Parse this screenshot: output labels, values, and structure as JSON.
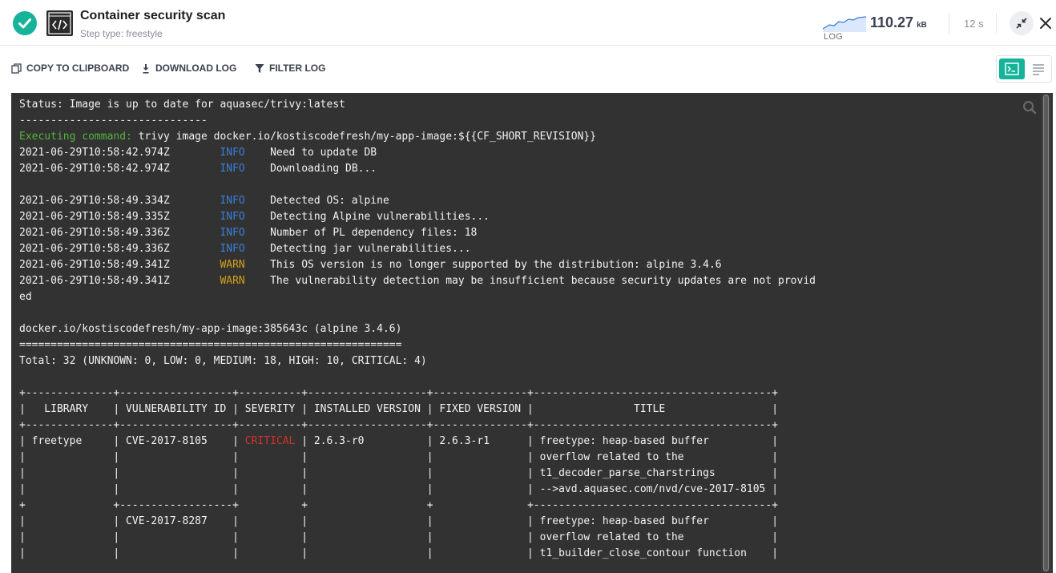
{
  "header": {
    "title": "Container security scan",
    "subtitle": "Step type: freestyle",
    "status_icon": "check-circle",
    "step_icon": "code-brackets",
    "log_label": "LOG",
    "log_size_value": "110.27",
    "log_size_unit": "kB",
    "duration": "12 s",
    "accent_color": "#15b39a"
  },
  "toolbar": {
    "copy_label": "COPY TO CLIPBOARD",
    "download_label": "DOWNLOAD LOG",
    "filter_label": "FILTER LOG"
  },
  "log": {
    "background": "#323232",
    "lines": [
      [
        {
          "t": "Status: Image is up to date for aquasec/trivy:latest"
        }
      ],
      [
        {
          "t": "------------------------------"
        }
      ],
      [
        {
          "t": "Executing command:",
          "c": "cmd"
        },
        {
          "t": " trivy image docker.io/kostiscodefresh/my-app-image:${{CF_SHORT_REVISION}}"
        }
      ],
      [
        {
          "t": "2021-06-29T10:58:42.974Z        "
        },
        {
          "t": "INFO",
          "c": "info"
        },
        {
          "t": "    Need to update DB"
        }
      ],
      [
        {
          "t": "2021-06-29T10:58:42.974Z        "
        },
        {
          "t": "INFO",
          "c": "info"
        },
        {
          "t": "    Downloading DB..."
        }
      ],
      [
        {
          "t": ""
        }
      ],
      [
        {
          "t": "2021-06-29T10:58:49.334Z        "
        },
        {
          "t": "INFO",
          "c": "info"
        },
        {
          "t": "    Detected OS: alpine"
        }
      ],
      [
        {
          "t": "2021-06-29T10:58:49.335Z        "
        },
        {
          "t": "INFO",
          "c": "info"
        },
        {
          "t": "    Detecting Alpine vulnerabilities..."
        }
      ],
      [
        {
          "t": "2021-06-29T10:58:49.336Z        "
        },
        {
          "t": "INFO",
          "c": "info"
        },
        {
          "t": "    Number of PL dependency files: 18"
        }
      ],
      [
        {
          "t": "2021-06-29T10:58:49.336Z        "
        },
        {
          "t": "INFO",
          "c": "info"
        },
        {
          "t": "    Detecting jar vulnerabilities..."
        }
      ],
      [
        {
          "t": "2021-06-29T10:58:49.341Z        "
        },
        {
          "t": "WARN",
          "c": "warn"
        },
        {
          "t": "    This OS version is no longer supported by the distribution: alpine 3.4.6"
        }
      ],
      [
        {
          "t": "2021-06-29T10:58:49.341Z        "
        },
        {
          "t": "WARN",
          "c": "warn"
        },
        {
          "t": "    The vulnerability detection may be insufficient because security updates are not provid"
        }
      ],
      [
        {
          "t": "ed"
        }
      ],
      [
        {
          "t": ""
        }
      ],
      [
        {
          "t": "docker.io/kostiscodefresh/my-app-image:385643c (alpine 3.4.6)"
        }
      ],
      [
        {
          "t": "============================================================="
        }
      ],
      [
        {
          "t": "Total: 32 (UNKNOWN: 0, LOW: 0, MEDIUM: 18, HIGH: 10, CRITICAL: 4)"
        }
      ],
      [
        {
          "t": ""
        }
      ],
      [
        {
          "t": "+--------------+------------------+----------+-------------------+---------------+--------------------------------------+"
        }
      ],
      [
        {
          "t": "|   LIBRARY    | VULNERABILITY ID | SEVERITY | INSTALLED VERSION | FIXED VERSION |                TITLE                 |"
        }
      ],
      [
        {
          "t": "+--------------+------------------+----------+-------------------+---------------+--------------------------------------+"
        }
      ],
      [
        {
          "t": "| freetype     | CVE-2017-8105    | "
        },
        {
          "t": "CRITICAL",
          "c": "crit"
        },
        {
          "t": " | 2.6.3-r0          | 2.6.3-r1      | freetype: heap-based buffer          |"
        }
      ],
      [
        {
          "t": "|              |                  |          |                   |               | overflow related to the              |"
        }
      ],
      [
        {
          "t": "|              |                  |          |                   |               | t1_decoder_parse_charstrings         |"
        }
      ],
      [
        {
          "t": "|              |                  |          |                   |               | -->avd.aquasec.com/nvd/cve-2017-8105 |"
        }
      ],
      [
        {
          "t": "+              +------------------+          +                   +               +--------------------------------------+"
        }
      ],
      [
        {
          "t": "|              | CVE-2017-8287    |          |                   |               | freetype: heap-based buffer          |"
        }
      ],
      [
        {
          "t": "|              |                  |          |                   |               | overflow related to the              |"
        }
      ],
      [
        {
          "t": "|              |                  |          |                   |               | t1_builder_close_contour function    |"
        }
      ]
    ]
  }
}
